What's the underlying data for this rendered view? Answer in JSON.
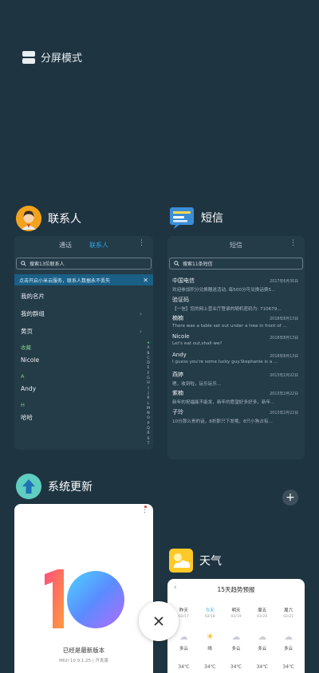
{
  "split_mode": {
    "label": "分屏模式"
  },
  "contacts": {
    "app_name": "联系人",
    "tabs": [
      "通话",
      "联系人"
    ],
    "search_placeholder": "搜索13位联系人",
    "notice": "点击开启小米云服务，联系人数据永不丢失",
    "rows": [
      "我的名片",
      "我的群组",
      "黄页"
    ],
    "sections": [
      {
        "letter": "N",
        "entries": [
          "Nicole"
        ]
      },
      {
        "letter": "A",
        "entries": [
          "Andy"
        ]
      },
      {
        "letter": "H",
        "entries": [
          "哈哈"
        ]
      }
    ],
    "section_first_label": "收藏",
    "index": [
      "★",
      "A",
      "B",
      "C",
      "D",
      "E",
      "F",
      "G",
      "H",
      "I",
      "J",
      "K",
      "L",
      "M",
      "N",
      "O",
      "P",
      "Q",
      "R",
      "S",
      "T"
    ]
  },
  "messages": {
    "app_name": "短信",
    "title": "短信",
    "search_placeholder": "搜索11条短信",
    "threads": [
      {
        "name": "中国电信",
        "time": "2017年6月30日",
        "preview": "欢迎参加积分兑换赠送活动, 每500分可兑换话费5..."
      },
      {
        "name": "验证码",
        "time": "",
        "preview": "【一信】您的网上营业厅登录的随机密码为: 710679..."
      },
      {
        "name": "楠楠",
        "time": "2018年8月13日",
        "preview": "There was a table set out under a tree in front of ..."
      },
      {
        "name": "Nicole",
        "time": "2018年8月13日",
        "preview": "Let's eat out,shall we?"
      },
      {
        "name": "Andy",
        "time": "2018年8月13日",
        "preview": "I guess you're some lucky guy.Stephanie is a ..."
      },
      {
        "name": "燕婷",
        "time": "2013年2月22日",
        "preview": "嗯，收到啦，玩乐玩乐..."
      },
      {
        "name": "紫楠",
        "time": "2013年2月22日",
        "preview": "新年的祝福能不能发，新年的愿望好多好多，新年..."
      },
      {
        "name": "子玲",
        "time": "2013年2月22日",
        "preview": "10分那么贵的话，8折那只下发哦，8只小狗占有..."
      }
    ]
  },
  "update": {
    "app_name": "系统更新",
    "status": "已经是最新版本",
    "version": "MIUI 10 9.1.25 | 开发版"
  },
  "weather": {
    "app_name": "天气",
    "title": "15天趋势预报",
    "days": [
      {
        "day": "昨天",
        "date": "02/17",
        "cond": "多云",
        "temp": "34℃"
      },
      {
        "day": "今天",
        "date": "02/18",
        "cond": "晴",
        "temp": "34℃"
      },
      {
        "day": "明天",
        "date": "02/19",
        "cond": "多云",
        "temp": "34℃"
      },
      {
        "day": "周五",
        "date": "02/20",
        "cond": "多云",
        "temp": "34℃"
      },
      {
        "day": "周六",
        "date": "02/21",
        "cond": "多云",
        "temp": "34℃"
      }
    ]
  },
  "colors": {
    "background": "#1f3441",
    "accent": "#29a8e8",
    "card": "#243b48"
  }
}
